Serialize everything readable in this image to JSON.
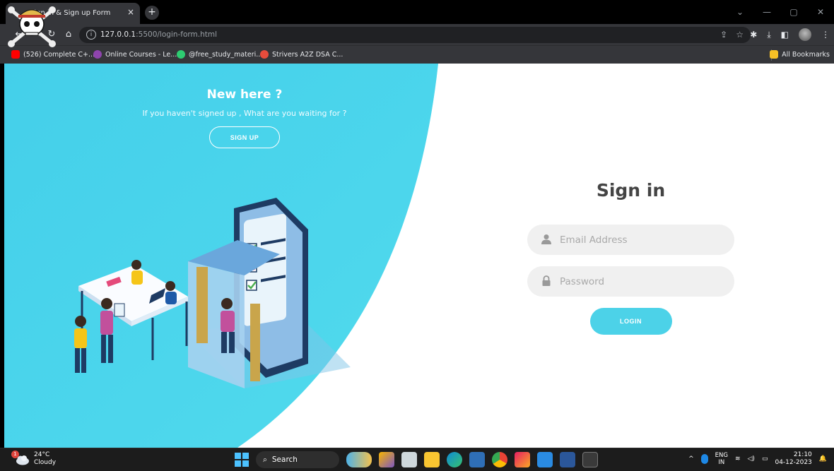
{
  "browser": {
    "tab_title": "Sign in & Sign up Form",
    "tab_close": "×",
    "tab_new": "+",
    "url_host": "127.0.0.1",
    "url_rest": ":5500/login-form.html",
    "bookmarks": [
      {
        "label": "(526) Complete C+...",
        "color": "#ff0000"
      },
      {
        "label": "Online Courses - Le...",
        "color": "#8e44ad"
      },
      {
        "label": "@free_study_materi...",
        "color": "#2ecc71"
      },
      {
        "label": "Strivers A2Z DSA C...",
        "color": "#e74c3c"
      }
    ],
    "all_bookmarks": "All Bookmarks"
  },
  "page": {
    "left": {
      "heading": "New here ?",
      "subtext": "If you haven't signed up , What are you waiting for ?",
      "signup_label": "SIGN UP"
    },
    "signin": {
      "title": "Sign in",
      "email_placeholder": "Email Address",
      "password_placeholder": "Password",
      "login_label": "LOGIN"
    },
    "colors": {
      "accent": "#4cd2e8",
      "panel": "#4ad6ec"
    }
  },
  "taskbar": {
    "weather_temp": "24°C",
    "weather_desc": "Cloudy",
    "weather_badge": "1",
    "search_label": "Search",
    "lang_top": "ENG",
    "lang_bottom": "IN",
    "time": "21:10",
    "date": "04-12-2023"
  }
}
